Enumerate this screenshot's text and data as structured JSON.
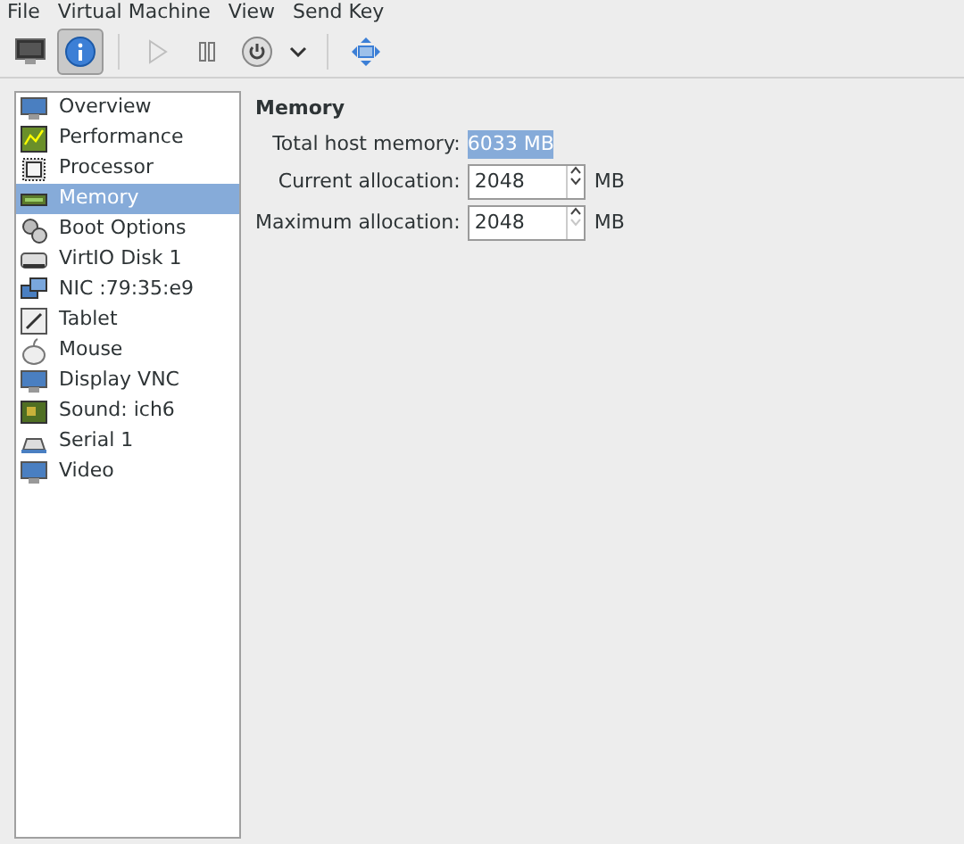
{
  "menu": [
    "File",
    "Virtual Machine",
    "View",
    "Send Key"
  ],
  "toolbar": [
    {
      "kind": "console",
      "selected": false,
      "disabled": false
    },
    {
      "kind": "details",
      "selected": true,
      "disabled": false
    },
    {
      "kind": "run",
      "selected": false,
      "disabled": true
    },
    {
      "kind": "pause",
      "selected": false,
      "disabled": false
    },
    {
      "kind": "power",
      "selected": false,
      "disabled": false
    },
    {
      "kind": "caret",
      "selected": false,
      "disabled": false
    },
    {
      "kind": "fullscreen",
      "selected": false,
      "disabled": false
    }
  ],
  "sidebar": {
    "items": [
      {
        "label": "Overview",
        "selected": false
      },
      {
        "label": "Performance",
        "selected": false
      },
      {
        "label": "Processor",
        "selected": false
      },
      {
        "label": "Memory",
        "selected": true
      },
      {
        "label": "Boot Options",
        "selected": false
      },
      {
        "label": "VirtIO Disk 1",
        "selected": false
      },
      {
        "label": "NIC :79:35:e9",
        "selected": false
      },
      {
        "label": "Tablet",
        "selected": false
      },
      {
        "label": "Mouse",
        "selected": false
      },
      {
        "label": "Display VNC",
        "selected": false
      },
      {
        "label": "Sound: ich6",
        "selected": false
      },
      {
        "label": "Serial 1",
        "selected": false
      },
      {
        "label": "Video",
        "selected": false
      }
    ]
  },
  "panel": {
    "title": "Memory",
    "total": {
      "label": "Total host memory:",
      "value": "6033 MB"
    },
    "fields": [
      {
        "label": "Current allocation:",
        "value": "2048",
        "unit": "MB",
        "down_disabled": false
      },
      {
        "label": "Maximum allocation:",
        "value": "2048",
        "unit": "MB",
        "down_disabled": true
      }
    ]
  }
}
